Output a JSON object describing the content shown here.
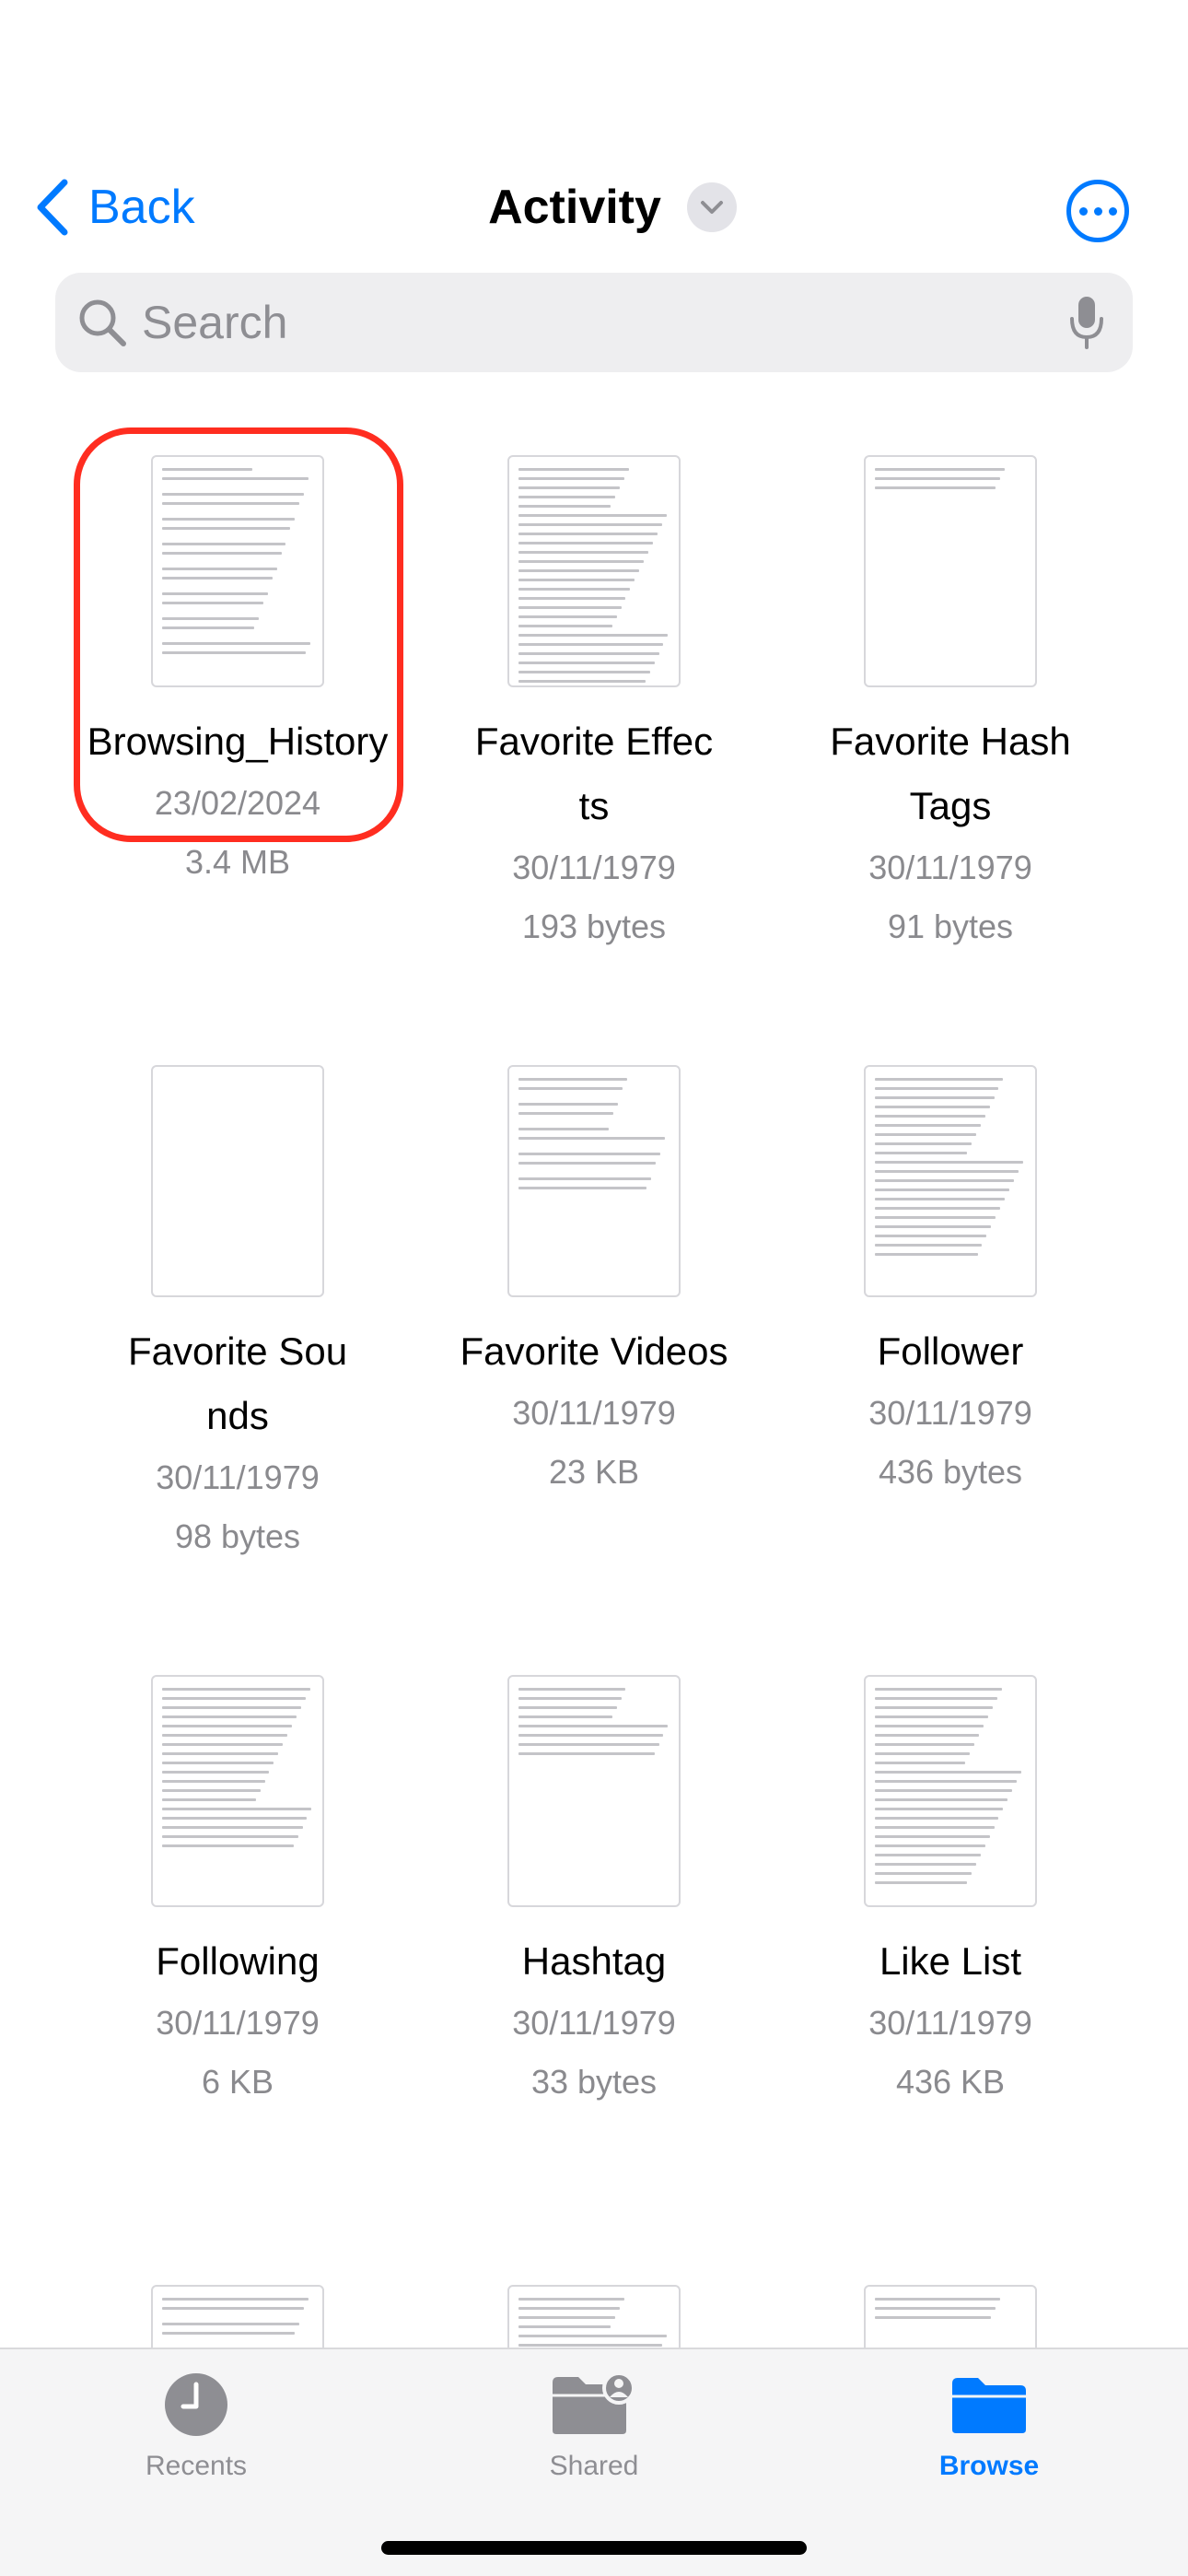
{
  "nav": {
    "back_label": "Back",
    "title": "Activity",
    "accent_color": "#007aff"
  },
  "search": {
    "placeholder": "Search"
  },
  "files": [
    {
      "name": "Browsing_History",
      "date": "23/02/2024",
      "size": "3.4 MB",
      "selected": true
    },
    {
      "name": "Favorite Effects",
      "date": "30/11/1979",
      "size": "193 bytes"
    },
    {
      "name": "Favorite HashTags",
      "date": "30/11/1979",
      "size": "91 bytes"
    },
    {
      "name": "Favorite Sounds",
      "date": "30/11/1979",
      "size": "98 bytes"
    },
    {
      "name": "Favorite Videos",
      "date": "30/11/1979",
      "size": "23 KB"
    },
    {
      "name": "Follower",
      "date": "30/11/1979",
      "size": "436 bytes"
    },
    {
      "name": "Following",
      "date": "30/11/1979",
      "size": "6 KB"
    },
    {
      "name": "Hashtag",
      "date": "30/11/1979",
      "size": "33 bytes"
    },
    {
      "name": "Like List",
      "date": "30/11/1979",
      "size": "436 KB"
    }
  ],
  "highlight_color": "#ff2d20",
  "tabbar": {
    "tabs": [
      {
        "label": "Recents",
        "icon": "clock-icon",
        "active": false
      },
      {
        "label": "Shared",
        "icon": "shared-folder-icon",
        "active": false
      },
      {
        "label": "Browse",
        "icon": "folder-icon",
        "active": true
      }
    ],
    "inactive_color": "#8e8e93",
    "active_color": "#007aff"
  }
}
